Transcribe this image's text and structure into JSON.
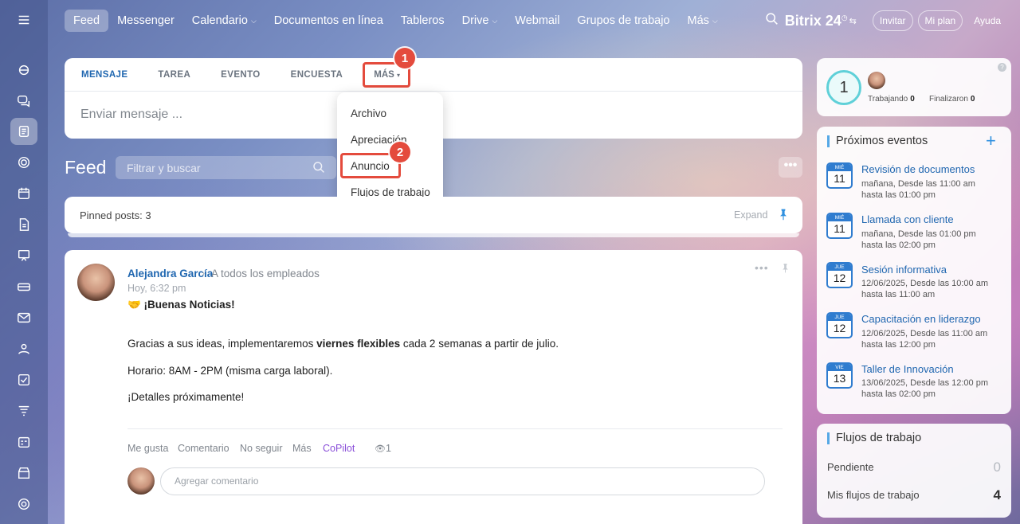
{
  "sidebar": {
    "items": [
      {
        "icon": "menu-icon"
      },
      {
        "icon": "shapes-icon"
      },
      {
        "icon": "chat-icon"
      },
      {
        "icon": "feed-icon"
      },
      {
        "icon": "circle-icon"
      },
      {
        "icon": "calendar-icon"
      },
      {
        "icon": "document-icon"
      },
      {
        "icon": "board-icon"
      },
      {
        "icon": "drive-icon"
      },
      {
        "icon": "mail-icon"
      },
      {
        "icon": "group-icon"
      },
      {
        "icon": "task-check-icon"
      },
      {
        "icon": "filter-icon"
      },
      {
        "icon": "schedule-icon"
      },
      {
        "icon": "store-icon"
      },
      {
        "icon": "settings-icon"
      }
    ]
  },
  "topnav": {
    "items": [
      "Feed",
      "Messenger",
      "Calendario",
      "Documentos en línea",
      "Tableros",
      "Drive",
      "Webmail",
      "Grupos de trabajo",
      "Más"
    ],
    "brand": "Bitrix 24",
    "invite": "Invitar",
    "plan": "Mi plan",
    "help": "Ayuda"
  },
  "composer": {
    "tabs": [
      "MENSAJE",
      "TAREA",
      "EVENTO",
      "ENCUESTA"
    ],
    "more_tab": "MÁS",
    "placeholder": "Enviar mensaje ..."
  },
  "badges": {
    "one": "1",
    "two": "2"
  },
  "dropdown": {
    "items": [
      "Archivo",
      "Apreciación",
      "Anuncio",
      "Flujos de trabajo"
    ]
  },
  "feed": {
    "title": "Feed",
    "search_placeholder": "Filtrar y buscar",
    "pinned_label": "Pinned posts: 3",
    "expand": "Expand"
  },
  "post": {
    "author": "Alejandra García",
    "to": "A todos los empleados",
    "time": "Hoy, 6:32 pm",
    "headline": "🤝 ¡Buenas Noticias!",
    "line1_pre": "Gracias a sus ideas, implementaremos ",
    "line1_bold": "viernes flexibles",
    "line1_post": " cada 2 semanas a partir de julio.",
    "line2": "Horario: 8AM - 2PM (misma carga laboral).",
    "line3": "¡Detalles próximamente!",
    "actions": [
      "Me gusta",
      "Comentario",
      "No seguir",
      "Más",
      "CoPilot"
    ],
    "views": "1",
    "comment_placeholder": "Agregar comentario"
  },
  "counter": {
    "value": "1",
    "working_label": "Trabajando",
    "working_value": "0",
    "finished_label": "Finalizaron",
    "finished_value": "0"
  },
  "events": {
    "title": "Próximos eventos",
    "items": [
      {
        "dow": "MIÉ",
        "day": "11",
        "title": "Revisión de documentos",
        "line1": "mañana, Desde las 11:00 am",
        "line2": "hasta las 01:00 pm"
      },
      {
        "dow": "MIÉ",
        "day": "11",
        "title": "Llamada con cliente",
        "line1": "mañana, Desde las 01:00 pm",
        "line2": "hasta las 02:00 pm"
      },
      {
        "dow": "JUE",
        "day": "12",
        "title": "Sesión informativa",
        "line1": "12/06/2025, Desde las 10:00 am",
        "line2": "hasta las 11:00 am"
      },
      {
        "dow": "JUE",
        "day": "12",
        "title": "Capacitación en liderazgo",
        "line1": "12/06/2025, Desde las 11:00 am",
        "line2": "hasta las 12:00 pm"
      },
      {
        "dow": "VIE",
        "day": "13",
        "title": "Taller de Innovación",
        "line1": "13/06/2025, Desde las 12:00 pm",
        "line2": "hasta las 02:00 pm"
      }
    ]
  },
  "workflows": {
    "title": "Flujos de trabajo",
    "pending_label": "Pendiente",
    "pending_value": "0",
    "mine_label": "Mis flujos de trabajo",
    "mine_value": "4"
  },
  "colors": {
    "accent": "#2067b0",
    "badge": "#e44b3d",
    "copilot": "#8a4fd9"
  }
}
